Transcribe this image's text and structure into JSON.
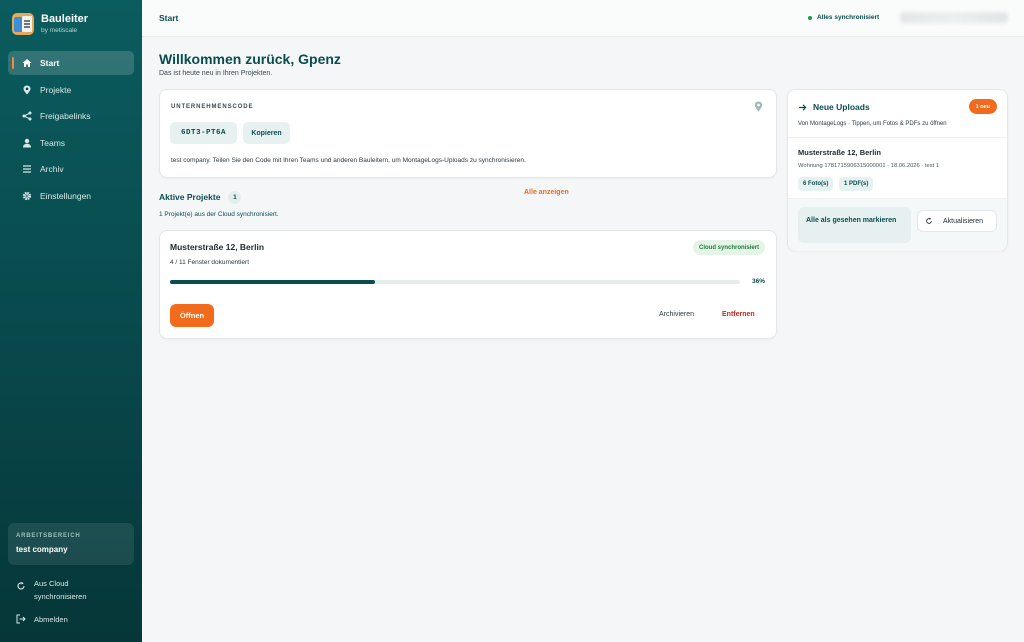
{
  "brand": {
    "title": "Bauleiter",
    "subtitle": "by metiscale"
  },
  "sidebar": {
    "items": [
      {
        "label": "Start",
        "icon": "home-icon"
      },
      {
        "label": "Projekte",
        "icon": "pin-icon"
      },
      {
        "label": "Freigabelinks",
        "icon": "share-icon"
      },
      {
        "label": "Teams",
        "icon": "user-icon"
      },
      {
        "label": "Archiv",
        "icon": "list-icon"
      },
      {
        "label": "Einstellungen",
        "icon": "gear-icon"
      }
    ],
    "workspace_label": "ARBEITSBEREICH",
    "workspace_name": "test company",
    "sync_line1": "Aus Cloud",
    "sync_line2": "synchronisieren",
    "logout": "Abmelden"
  },
  "topbar": {
    "title": "Start",
    "sync_status": "Alles synchronisiert"
  },
  "welcome": {
    "heading": "Willkommen zurück, Gpenz",
    "subheading": "Das ist heute neu in Ihren Projekten."
  },
  "company_code": {
    "label": "UNTERNEHMENSCODE",
    "code": "6DT3-PT6A",
    "copy_label": "Kopieren",
    "description": "test company. Teilen Sie den Code mit Ihren Teams und anderen Bauleitern, um MontageLogs-Uploads zu synchronisieren."
  },
  "active_projects": {
    "title": "Aktive Projekte",
    "count": "1",
    "show_all": "Alle anzeigen",
    "sync_note": "1 Projekt(e) aus der Cloud synchronisiert."
  },
  "project": {
    "title": "Musterstraße 12, Berlin",
    "subtitle": "4 / 11 Fenster dokumentiert",
    "badge": "Cloud synchronisiert",
    "progress": 0.36,
    "progress_label": "36%",
    "open_label": "Öffnen",
    "archive_label": "Archivieren",
    "remove_label": "Entfernen"
  },
  "uploads": {
    "title": "Neue Uploads",
    "badge": "1 neu",
    "description": "Von MontageLogs · Tippen, um Fotos & PDFs zu öffnen",
    "item_title": "Musterstraße 12, Berlin",
    "item_meta": "Wohnung 1781715906315000001 · 18.06.2026 · test 1",
    "photos": "6 Foto(s)",
    "pdfs": "1 PDF(s)",
    "seen_label": "Alle als gesehen markieren",
    "refresh_label": "Aktualisieren"
  },
  "colors": {
    "accent": "#f26b1d",
    "brand": "#0a4d4f",
    "success": "#1f9a4d"
  }
}
